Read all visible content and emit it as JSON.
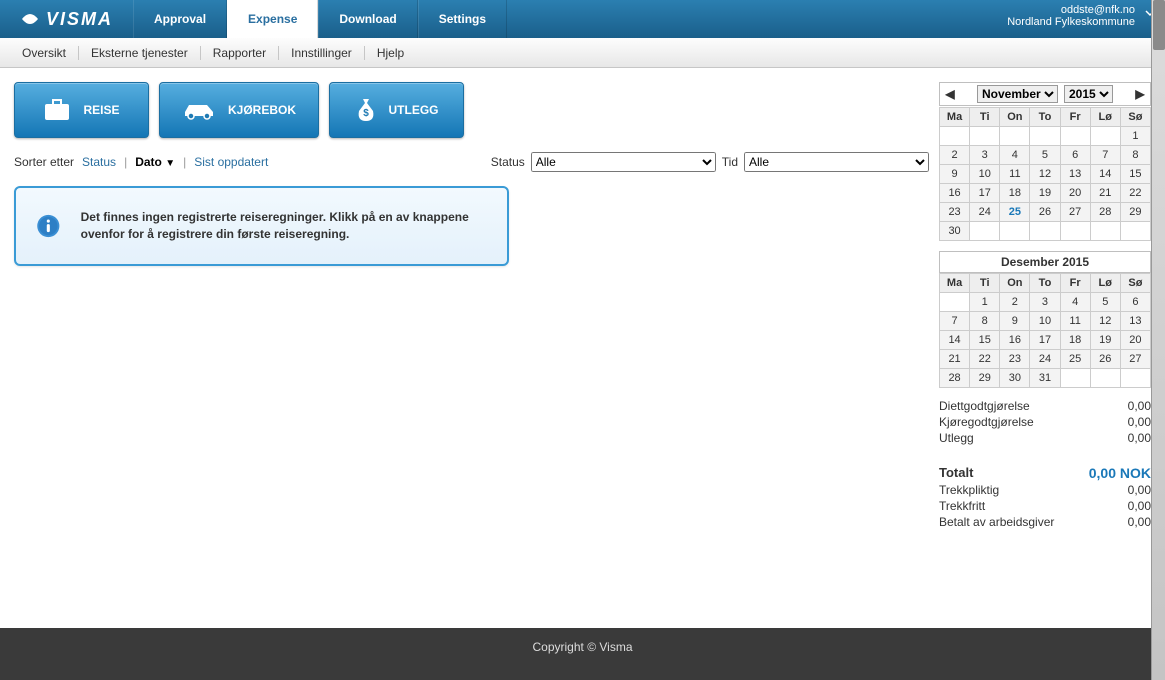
{
  "brand": "VISMA",
  "toptabs": [
    {
      "label": "Approval"
    },
    {
      "label": "Expense",
      "active": true
    },
    {
      "label": "Download"
    },
    {
      "label": "Settings"
    }
  ],
  "user": {
    "email": "oddste@nfk.no",
    "org": "Nordland Fylkeskommune"
  },
  "subtabs": [
    "Oversikt",
    "Eksterne tjenester",
    "Rapporter",
    "Innstillinger",
    "Hjelp"
  ],
  "bigbuttons": {
    "reise": "REISE",
    "kjorebok": "KJØREBOK",
    "utlegg": "UTLEGG"
  },
  "sort": {
    "label": "Sorter etter",
    "status": "Status",
    "dato": "Dato",
    "sist": "Sist oppdatert"
  },
  "filters": {
    "status_label": "Status",
    "status_value": "Alle",
    "tid_label": "Tid",
    "tid_value": "Alle"
  },
  "info_message": "Det finnes ingen registrerte reiseregninger. Klikk på en av knappene ovenfor for å registrere din første reiseregning.",
  "calendar": {
    "month_select": "November",
    "year_select": "2015",
    "weekdays": [
      "Ma",
      "Ti",
      "On",
      "To",
      "Fr",
      "Lø",
      "Sø"
    ],
    "nov_title": "November 2015",
    "nov_today": 25,
    "dec_title": "Desember 2015"
  },
  "summary": {
    "diett_k": "Diettgodtgjørelse",
    "diett_v": "0,00",
    "kjore_k": "Kjøregodtgjørelse",
    "kjore_v": "0,00",
    "utlegg_k": "Utlegg",
    "utlegg_v": "0,00",
    "totalt_k": "Totalt",
    "totalt_v": "0,00 NOK",
    "trekkpl_k": "Trekkpliktig",
    "trekkpl_v": "0,00",
    "trekkfr_k": "Trekkfritt",
    "trekkfr_v": "0,00",
    "betalt_k": "Betalt av arbeidsgiver",
    "betalt_v": "0,00"
  },
  "footer": "Copyright © Visma"
}
